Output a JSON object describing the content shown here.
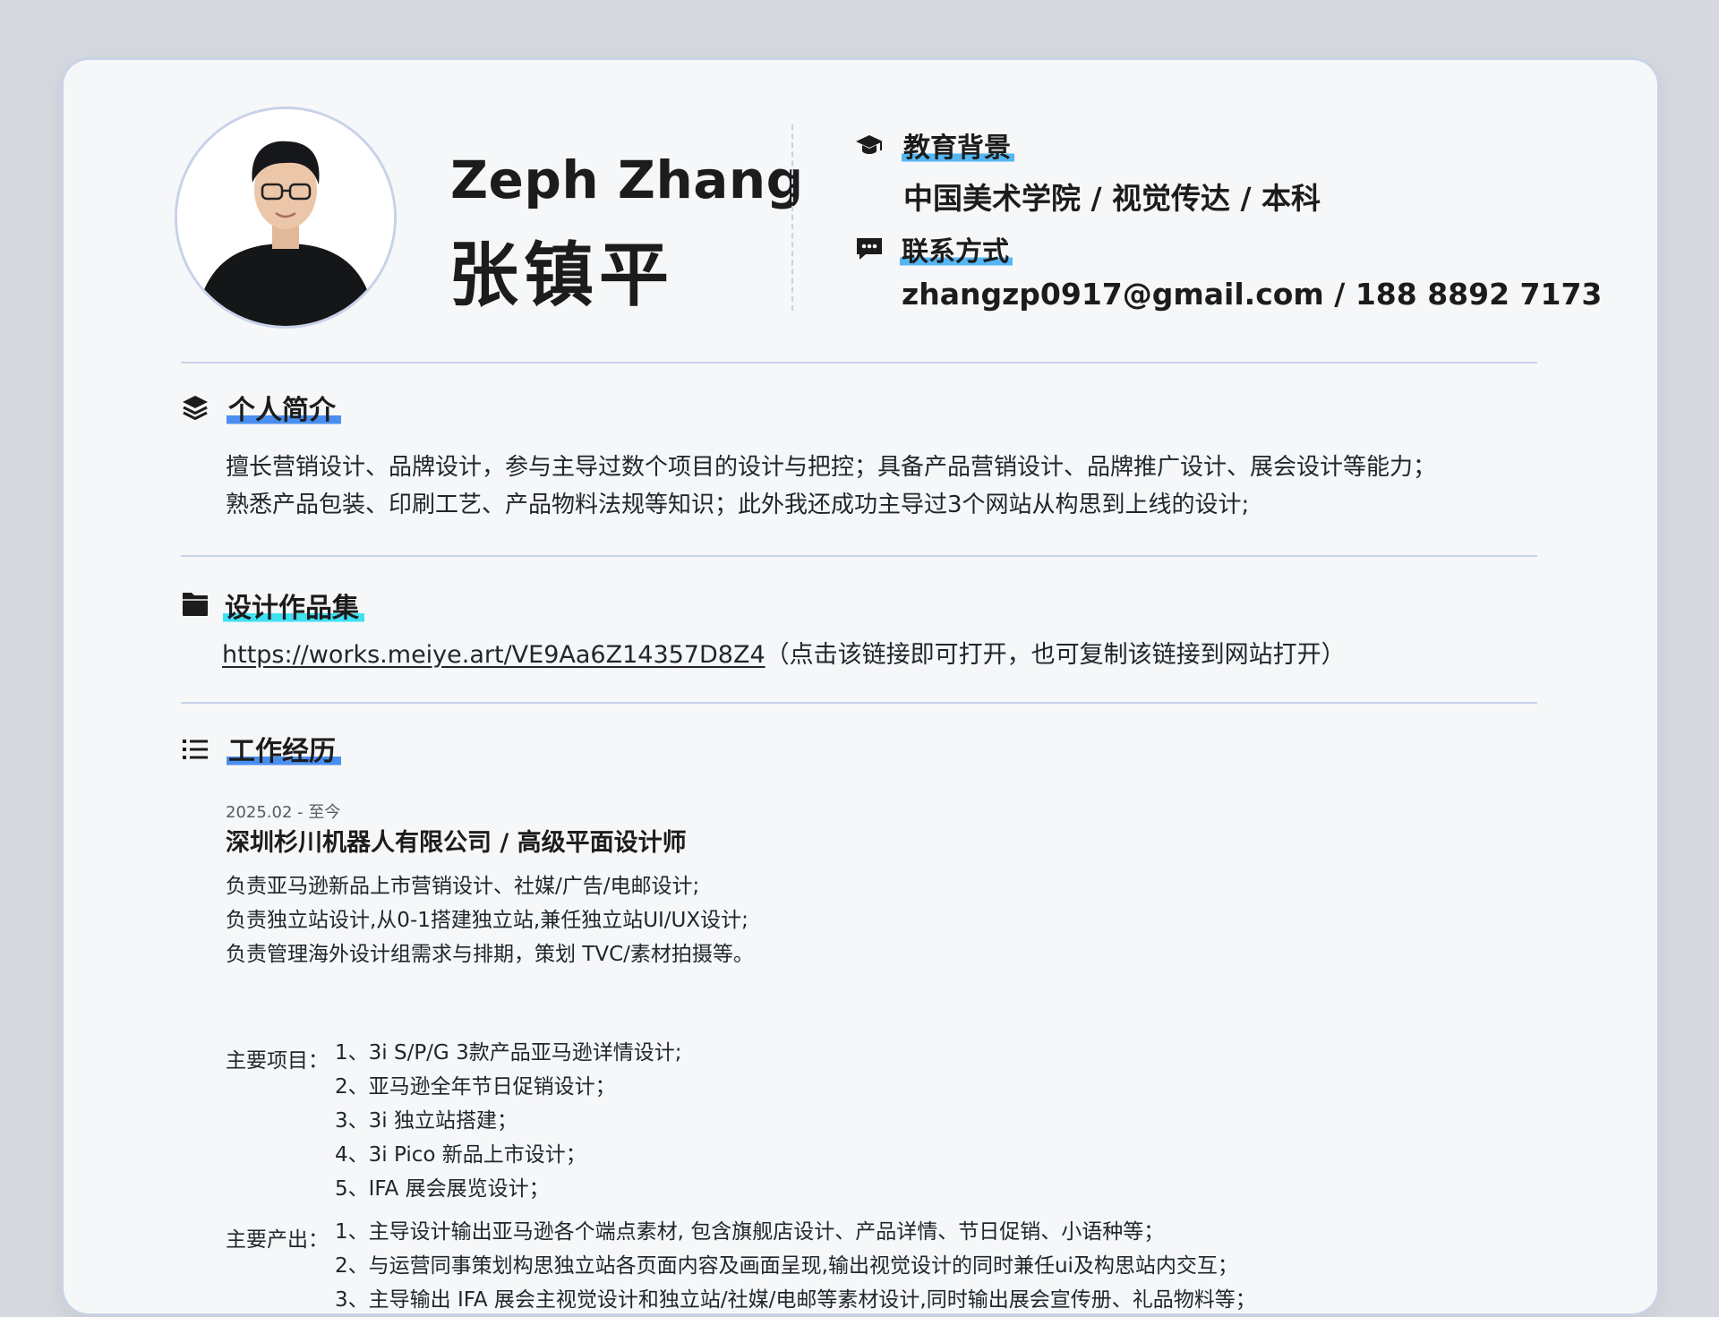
{
  "header": {
    "name_en": "Zeph Zhang",
    "name_cn": "张镇平",
    "education": {
      "label": "教育背景",
      "value": "中国美术学院 / 视觉传达 / 本科"
    },
    "contact": {
      "label": "联系方式",
      "value": "zhangzp0917@gmail.com  / 188 8892 7173"
    }
  },
  "profile": {
    "title": "个人简介",
    "lines": [
      "擅长营销设计、品牌设计，参与主导过数个项目的设计与把控；具备产品营销设计、品牌推广设计、展会设计等能力；",
      "熟悉产品包装、印刷工艺、产品物料法规等知识；此外我还成功主导过3个网站从构思到上线的设计;"
    ]
  },
  "portfolio": {
    "title": "设计作品集",
    "url": "https://works.meiye.art/VE9Aa6Z14357D8Z4",
    "note": "（点击该链接即可打开，也可复制该链接到网站打开）"
  },
  "experience": {
    "title": "工作经历",
    "date": "2025.02 - 至今",
    "company": "深圳杉川机器人有限公司 / 高级平面设计师",
    "duties": [
      "负责亚马逊新品上市营销设计、社媒/广告/电邮设计;",
      "负责独立站设计,从0-1搭建独立站,兼任独立站UI/UX设计;",
      "负责管理海外设计组需求与排期，策划 TVC/素材拍摄等。"
    ],
    "projects_label": "主要项目：",
    "projects": [
      "1、3i S/P/G 3款产品亚马逊详情设计;",
      "2、亚马逊全年节日促销设计；",
      "3、3i 独立站搭建；",
      "4、3i Pico 新品上市设计；",
      "5、IFA 展会展览设计；"
    ],
    "outputs_label": "主要产出：",
    "outputs": [
      "1、主导设计输出亚马逊各个端点素材, 包含旗舰店设计、产品详情、节日促销、小语种等；",
      "2、与运营同事策划构思独立站各页面内容及画面呈现,输出视觉设计的同时兼任ui及构思站内交互；",
      "3、主导输出 IFA 展会主视觉设计和独立站/社媒/电邮等素材设计,同时输出展会宣传册、礼品物料等；"
    ]
  },
  "colors": {
    "accent_blue": "#4a8ef0",
    "accent_cyan": "#3fe0f2",
    "accent_sky": "#55b6f3",
    "divider": "#c8d3e8"
  },
  "icons": [
    "graduation-cap-icon",
    "chat-icon",
    "layers-icon",
    "folder-icon",
    "list-icon"
  ]
}
